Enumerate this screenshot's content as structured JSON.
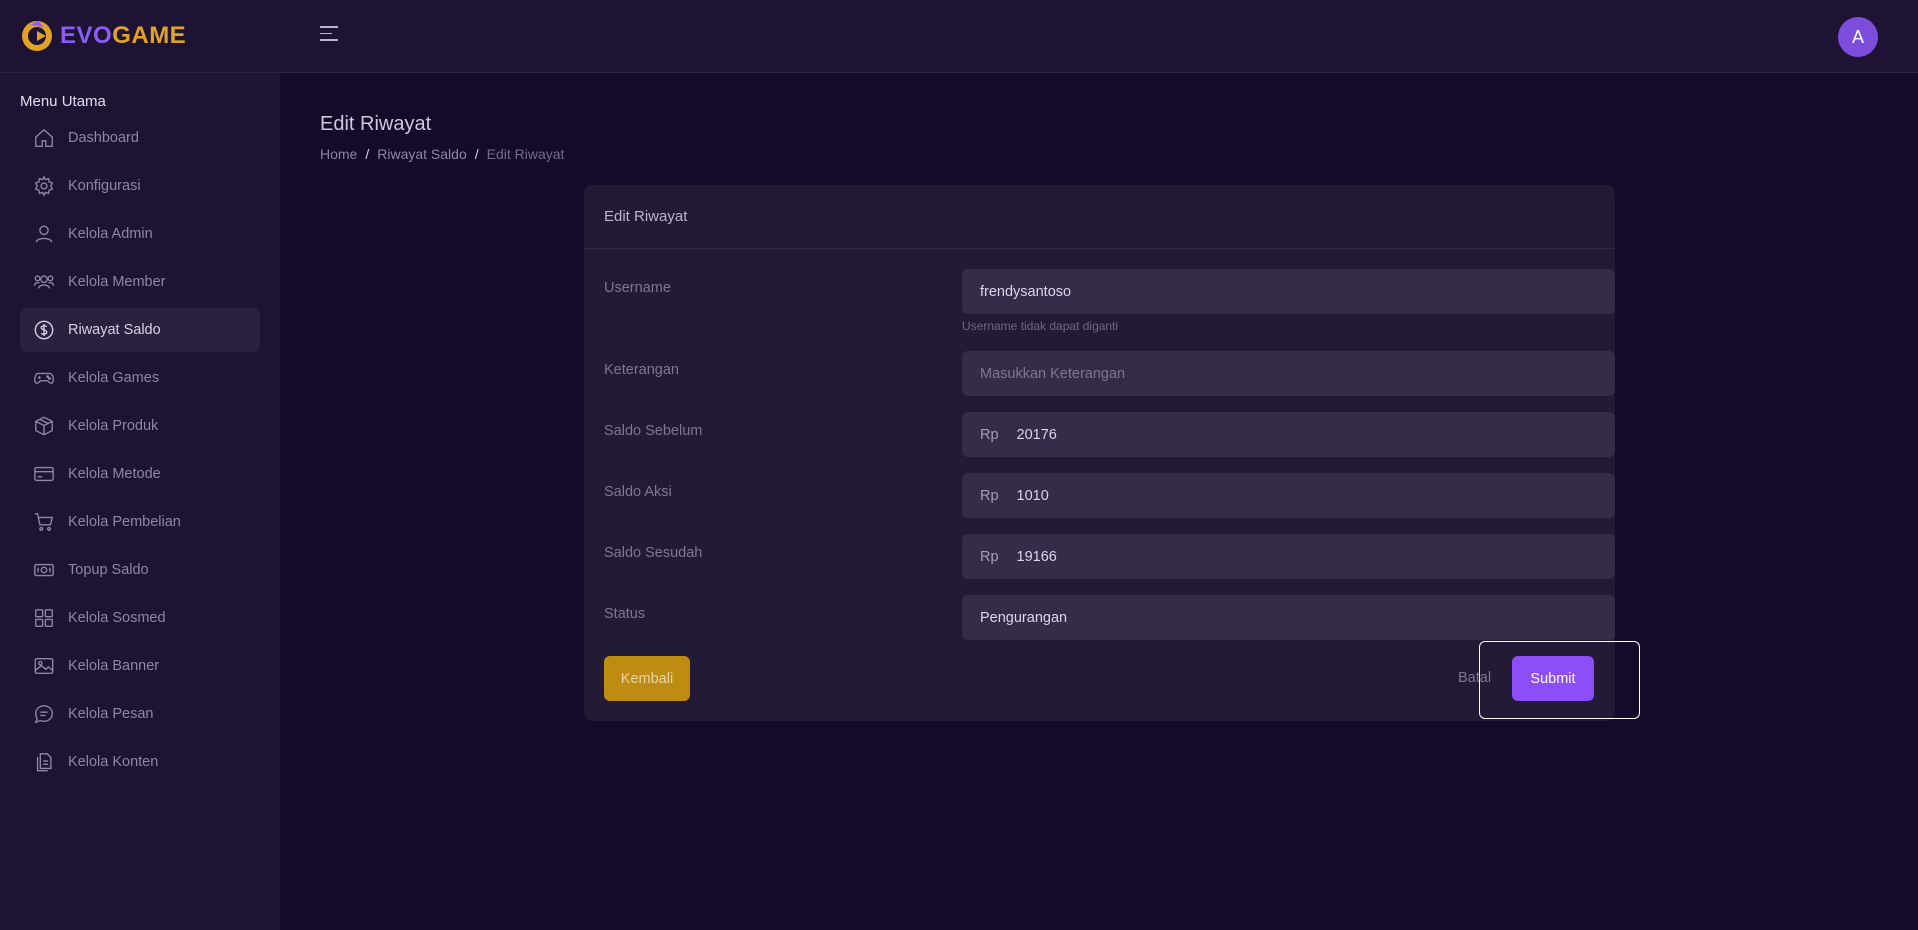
{
  "brand": {
    "part1": "EVO",
    "part2": "GAME",
    "colors": {
      "evo": "#8b5cf6",
      "game": "#e0a325"
    }
  },
  "header": {
    "avatar_initial": "A",
    "menu_icon": "hamburger-icon"
  },
  "sidebar": {
    "heading": "Menu Utama",
    "items": [
      {
        "label": "Dashboard",
        "icon": "home-icon"
      },
      {
        "label": "Konfigurasi",
        "icon": "gear-icon"
      },
      {
        "label": "Kelola Admin",
        "icon": "user-icon"
      },
      {
        "label": "Kelola Member",
        "icon": "users-icon"
      },
      {
        "label": "Riwayat Saldo",
        "icon": "dollar-circle-icon",
        "active": true
      },
      {
        "label": "Kelola Games",
        "icon": "gamepad-icon"
      },
      {
        "label": "Kelola Produk",
        "icon": "box-icon"
      },
      {
        "label": "Kelola Metode",
        "icon": "credit-card-icon"
      },
      {
        "label": "Kelola Pembelian",
        "icon": "cart-icon"
      },
      {
        "label": "Topup Saldo",
        "icon": "money-icon"
      },
      {
        "label": "Kelola Sosmed",
        "icon": "grid-icon"
      },
      {
        "label": "Kelola Banner",
        "icon": "image-icon"
      },
      {
        "label": "Kelola Pesan",
        "icon": "chat-icon"
      },
      {
        "label": "Kelola Konten",
        "icon": "document-icon"
      }
    ]
  },
  "page": {
    "title": "Edit Riwayat",
    "breadcrumb": [
      "Home",
      "Riwayat Saldo",
      "Edit Riwayat"
    ]
  },
  "form": {
    "card_title": "Edit Riwayat",
    "username": {
      "label": "Username",
      "value": "frendysantoso",
      "hint": "Username tidak dapat diganti"
    },
    "keterangan": {
      "label": "Keterangan",
      "placeholder": "Masukkan Keterangan",
      "value": ""
    },
    "saldo_sebelum": {
      "label": "Saldo Sebelum",
      "prefix": "Rp",
      "value": "20176"
    },
    "saldo_aksi": {
      "label": "Saldo Aksi",
      "prefix": "Rp",
      "value": "1010"
    },
    "saldo_sesudah": {
      "label": "Saldo Sesudah",
      "prefix": "Rp",
      "value": "19166"
    },
    "status": {
      "label": "Status",
      "value": "Pengurangan"
    },
    "buttons": {
      "back": "Kembali",
      "cancel": "Batal",
      "submit": "Submit"
    }
  }
}
